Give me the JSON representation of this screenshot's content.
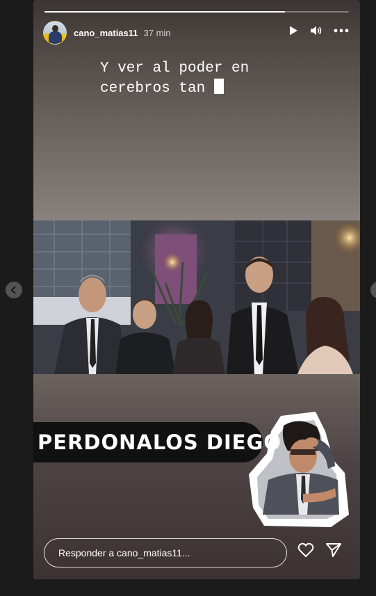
{
  "story": {
    "progress": 0.79,
    "username": "cano_matias11",
    "time": "37 min",
    "caption_lines": [
      "Y ver al poder en",
      "cerebros tan "
    ],
    "sticker_text": "PERDONALOS DIEGO",
    "reply_placeholder": "Responder a cano_matias11..."
  },
  "icons": {
    "play": "play-icon",
    "volume": "volume-icon",
    "more": "more-options-icon",
    "heart": "heart-icon",
    "send": "send-icon",
    "prev": "chevron-left-icon",
    "next": "chevron-right-icon"
  },
  "colors": {
    "page_background": "#1b1b1b",
    "text": "#ffffff",
    "sticker_background": "#111111"
  }
}
